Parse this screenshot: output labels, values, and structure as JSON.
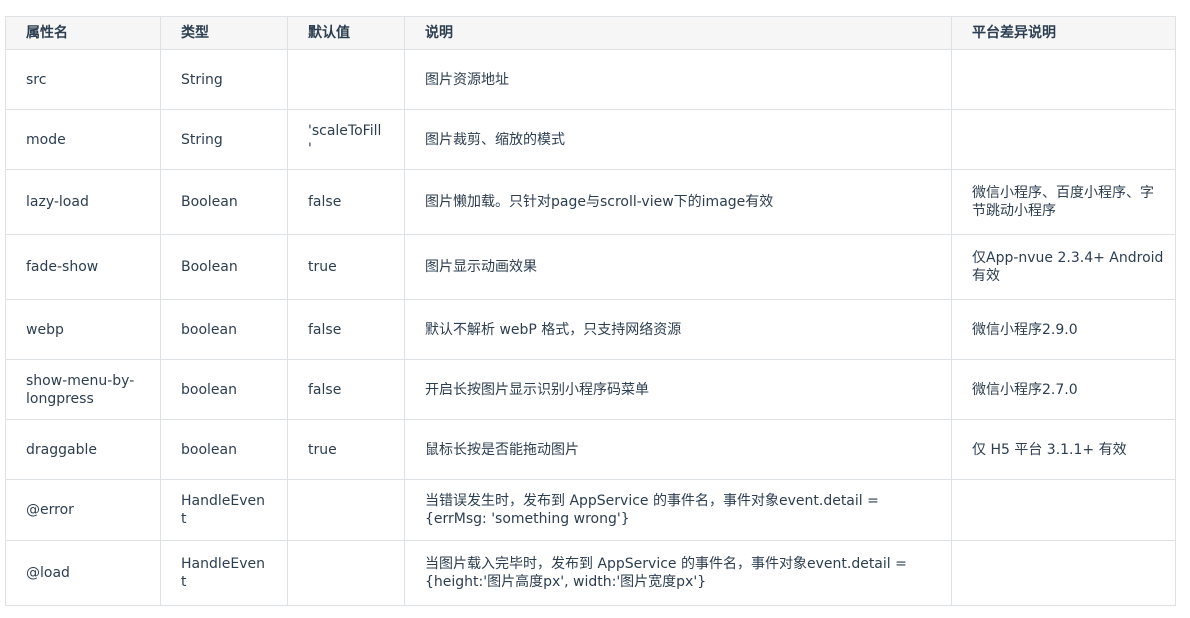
{
  "table": {
    "headers": [
      "属性名",
      "类型",
      "默认值",
      "说明",
      "平台差异说明"
    ],
    "rows": [
      {
        "name": "src",
        "type": "String",
        "default": "",
        "desc": "图片资源地址",
        "platform": ""
      },
      {
        "name": "mode",
        "type": "String",
        "default": "'scaleToFill'",
        "desc": "图片裁剪、缩放的模式",
        "platform": ""
      },
      {
        "name": "lazy-load",
        "type": "Boolean",
        "default": "false",
        "desc": "图片懒加载。只针对page与scroll-view下的image有效",
        "platform": "微信小程序、百度小程序、字节跳动小程序"
      },
      {
        "name": "fade-show",
        "type": "Boolean",
        "default": "true",
        "desc": "图片显示动画效果",
        "platform": "仅App-nvue 2.3.4+ Android有效"
      },
      {
        "name": "webp",
        "type": "boolean",
        "default": "false",
        "desc": "默认不解析 webP 格式，只支持网络资源",
        "platform": "微信小程序2.9.0"
      },
      {
        "name": "show-menu-by-longpress",
        "type": "boolean",
        "default": "false",
        "desc": "开启长按图片显示识别小程序码菜单",
        "platform": "微信小程序2.7.0"
      },
      {
        "name": "draggable",
        "type": "boolean",
        "default": "true",
        "desc": "鼠标长按是否能拖动图片",
        "platform": "仅 H5 平台 3.1.1+ 有效"
      },
      {
        "name": "@error",
        "type": "HandleEvent",
        "default": "",
        "desc": "当错误发生时，发布到 AppService 的事件名，事件对象event.detail = {errMsg: 'something wrong'}",
        "platform": ""
      },
      {
        "name": "@load",
        "type": "HandleEvent",
        "default": "",
        "desc": "当图片载入完毕时，发布到 AppService 的事件名，事件对象event.detail = {height:'图片高度px', width:'图片宽度px'}",
        "platform": ""
      }
    ]
  }
}
